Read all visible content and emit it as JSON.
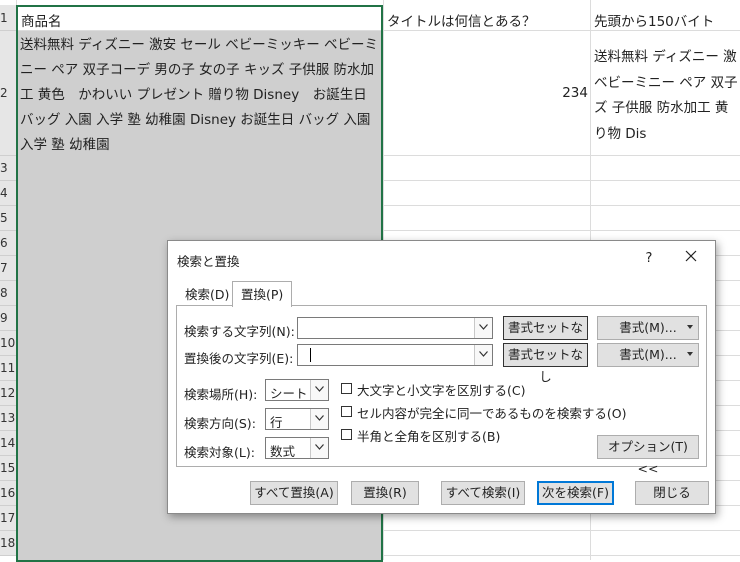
{
  "sheet": {
    "rows": [
      "1",
      "2",
      "3",
      "4",
      "5",
      "6",
      "7",
      "8",
      "9",
      "10",
      "11",
      "12",
      "13",
      "14",
      "15",
      "16",
      "17",
      "18"
    ],
    "header_row": {
      "a": "商品名",
      "b": "タイトルは何信とある？",
      "c": "先頭から150バイト"
    },
    "row2": {
      "a": "送料無料 ディズニー 激安 セール ベビーミッキー ベビーミニー ペア 双子コーデ 男の子 女の子 キッズ 子供服 防水加工 黄色　かわいい プレゼント 贈り物 Disney　お誕生日 バッグ 入園 入学 塾 幼稚園 Disney お誕生日 バッグ 入園 入学 塾 幼稚園",
      "b": "234",
      "c_lines": [
        "送料無料 ディズニー 激",
        "ベビーミニー ペア 双子",
        "ズ 子供服 防水加工 黄",
        "り物 Dis"
      ]
    }
  },
  "dialog": {
    "title": "検索と置換",
    "help": "?",
    "close": "✕",
    "tabs": {
      "search": "検索(D)",
      "replace": "置換(P)"
    },
    "find_label": "検索する文字列(N):",
    "find_value": "",
    "replace_label": "置換後の文字列(E):",
    "replace_value": "",
    "no_format_1": "書式セットなし",
    "no_format_2": "書式セットなし",
    "format_1": "書式(M)...",
    "format_2": "書式(M)...",
    "within_label": "検索場所(H):",
    "within_value": "シート",
    "search_label": "検索方向(S):",
    "search_value": "行",
    "lookin_label": "検索対象(L):",
    "lookin_value": "数式",
    "match_case": "大文字と小文字を区別する(C)",
    "match_entire": "セル内容が完全に同一であるものを検索する(O)",
    "match_width": "半角と全角を区別する(B)",
    "options": "オプション(T) <<",
    "replace_all": "すべて置換(A)",
    "replace": "置換(R)",
    "find_all": "すべて検索(I)",
    "find_next": "次を検索(F)",
    "close_btn": "閉じる"
  }
}
